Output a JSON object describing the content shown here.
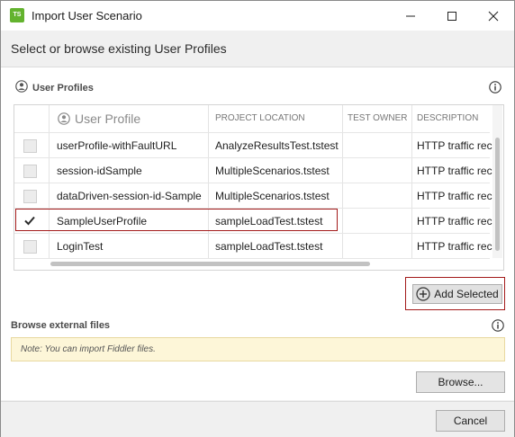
{
  "window": {
    "title": "Import User Scenario",
    "app_icon_text": "TS"
  },
  "header": {
    "subtitle": "Select or browse existing User Profiles"
  },
  "profiles_section": {
    "label": "User Profiles",
    "columns": {
      "name": "User Profile",
      "location": "PROJECT LOCATION",
      "owner": "TEST OWNER",
      "description": "DESCRIPTION"
    },
    "rows": [
      {
        "checked": false,
        "name": "userProfile-withFaultURL",
        "location": "AnalyzeResultsTest.tstest",
        "owner": "",
        "description": "HTTP traffic reco"
      },
      {
        "checked": false,
        "name": "session-idSample",
        "location": "MultipleScenarios.tstest",
        "owner": "",
        "description": "HTTP traffic reco"
      },
      {
        "checked": false,
        "name": "dataDriven-session-id-Sample",
        "location": "MultipleScenarios.tstest",
        "owner": "",
        "description": "HTTP traffic reco"
      },
      {
        "checked": true,
        "name": "SampleUserProfile",
        "location": "sampleLoadTest.tstest",
        "owner": "",
        "description": "HTTP traffic reco"
      },
      {
        "checked": false,
        "name": "LoginTest",
        "location": "sampleLoadTest.tstest",
        "owner": "",
        "description": "HTTP traffic reco"
      }
    ],
    "add_selected_label": "Add Selected"
  },
  "browse_section": {
    "label": "Browse external files",
    "note": "Note: You can import Fiddler files.",
    "browse_label": "Browse..."
  },
  "footer": {
    "cancel_label": "Cancel"
  },
  "colors": {
    "highlight_border": "#a31a1a",
    "app_icon": "#63b32e",
    "note_background": "#fdf6d8"
  }
}
